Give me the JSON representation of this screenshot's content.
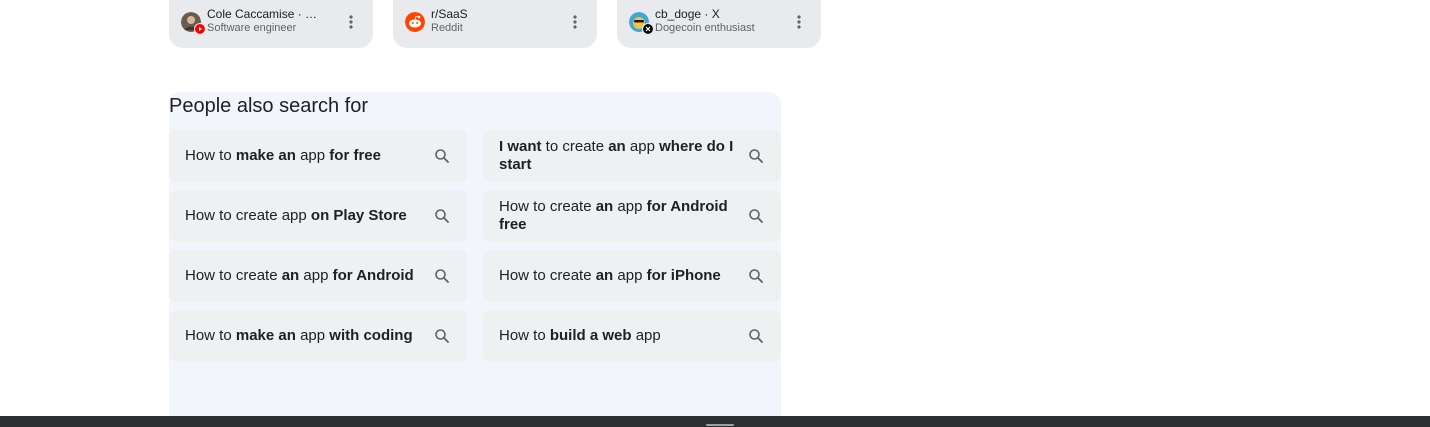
{
  "sources": [
    {
      "title": "Cole Caccamise · …",
      "subtitle": "Software engineer",
      "avatar_icon": "person-photo-icon",
      "badge_icon": "youtube-icon",
      "badge_color": "#ff0000"
    },
    {
      "title": "r/SaaS",
      "subtitle": "Reddit",
      "avatar_icon": "reddit-icon",
      "avatar_color": "#ff4500"
    },
    {
      "title": "cb_doge · X",
      "subtitle": "Dogecoin enthusiast",
      "avatar_icon": "doge-avatar-icon",
      "badge_icon": "x-icon",
      "badge_color": "#000000"
    }
  ],
  "people_also_search": {
    "title": "People also search for",
    "items": [
      {
        "parts": [
          [
            "How to ",
            false
          ],
          [
            "make an",
            true
          ],
          [
            " app ",
            false
          ],
          [
            "for free",
            true
          ]
        ]
      },
      {
        "parts": [
          [
            "I want",
            true
          ],
          [
            " to create ",
            false
          ],
          [
            "an",
            true
          ],
          [
            " app ",
            false
          ],
          [
            "where do I start",
            true
          ]
        ]
      },
      {
        "parts": [
          [
            "How to create app ",
            false
          ],
          [
            "on Play Store",
            true
          ]
        ]
      },
      {
        "parts": [
          [
            "How to create ",
            false
          ],
          [
            "an",
            true
          ],
          [
            " app ",
            false
          ],
          [
            "for Android free",
            true
          ]
        ]
      },
      {
        "parts": [
          [
            "How to create ",
            false
          ],
          [
            "an",
            true
          ],
          [
            " app ",
            false
          ],
          [
            "for Android",
            true
          ]
        ]
      },
      {
        "parts": [
          [
            "How to create ",
            false
          ],
          [
            "an",
            true
          ],
          [
            " app ",
            false
          ],
          [
            "for iPhone",
            true
          ]
        ]
      },
      {
        "parts": [
          [
            "How to ",
            false
          ],
          [
            "make an",
            true
          ],
          [
            " app ",
            false
          ],
          [
            "with coding",
            true
          ]
        ]
      },
      {
        "parts": [
          [
            "How to ",
            false
          ],
          [
            "build a web",
            true
          ],
          [
            " app",
            false
          ]
        ]
      }
    ]
  },
  "colors": {
    "card_bg": "#e9eaed",
    "panel_bg": "#f2f5fc",
    "chip_bg": "#eff0f2",
    "bottom_bar": "#2d2e31"
  }
}
